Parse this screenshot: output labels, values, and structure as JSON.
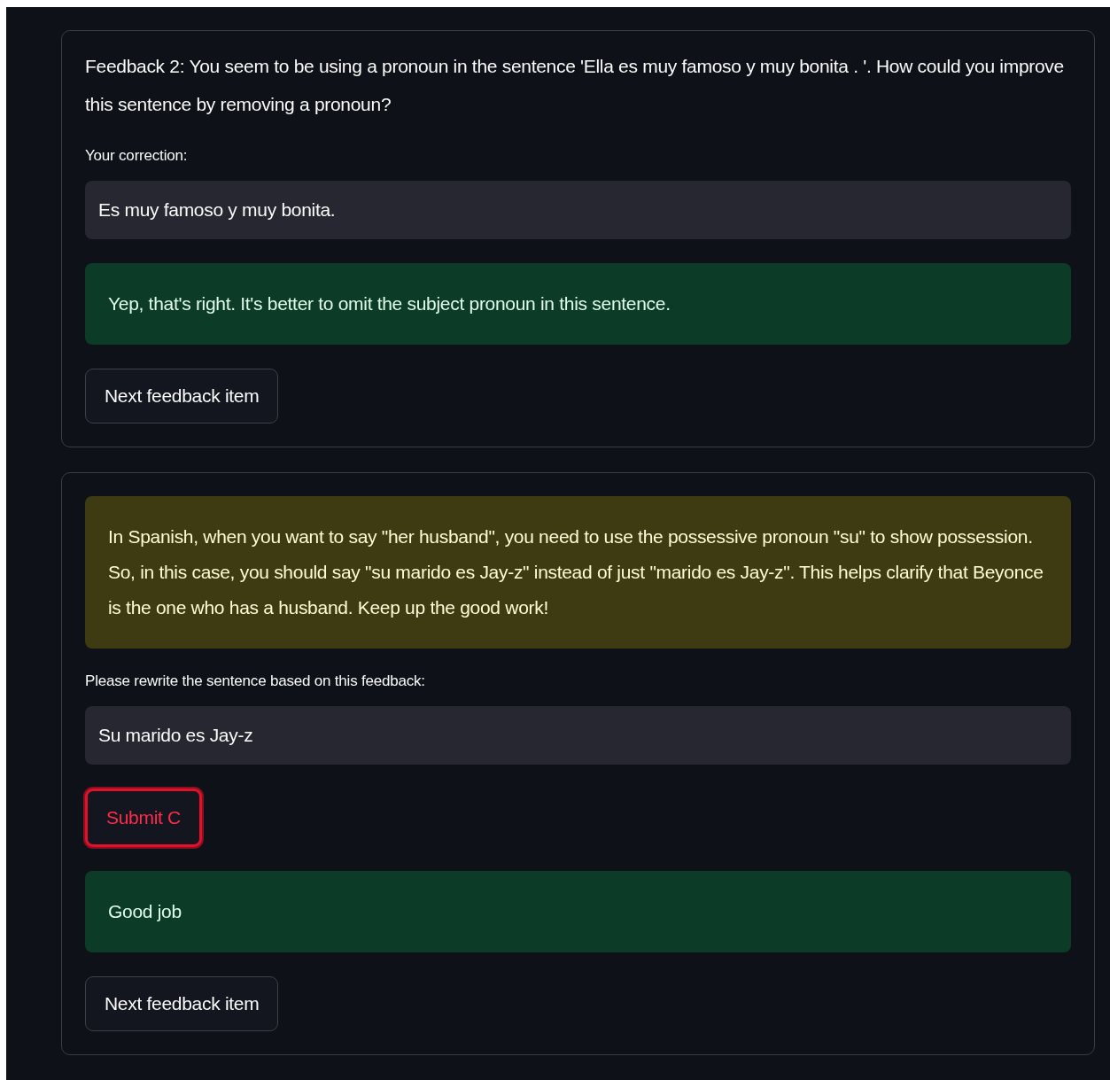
{
  "cards": [
    {
      "items": [
        {
          "kind": "prompt",
          "text": "Feedback 2: You seem to be using a pronoun in the sentence 'Ella es muy famoso y muy bonita . '. How could you improve this sentence by removing a pronoun?"
        },
        {
          "kind": "label",
          "text": "Your correction:"
        },
        {
          "kind": "input",
          "value": "Es muy famoso y muy bonita."
        },
        {
          "kind": "success",
          "text": "Yep, that's right. It's better to omit the subject pronoun in this sentence."
        },
        {
          "kind": "button",
          "label": "Next feedback item",
          "focused": false
        }
      ]
    },
    {
      "items": [
        {
          "kind": "warning",
          "text": "In Spanish, when you want to say \"her husband\", you need to use the possessive pronoun \"su\" to show possession. So, in this case, you should say \"su marido es Jay-z\" instead of just \"marido es Jay-z\". This helps clarify that Beyonce is the one who has a husband. Keep up the good work!"
        },
        {
          "kind": "label",
          "text": "Please rewrite the sentence based on this feedback:"
        },
        {
          "kind": "input",
          "value": "Su marido es Jay-z"
        },
        {
          "kind": "button",
          "label": "Submit C",
          "focused": true
        },
        {
          "kind": "success",
          "text": "Good job"
        },
        {
          "kind": "button",
          "label": "Next feedback item",
          "focused": false
        }
      ]
    }
  ]
}
